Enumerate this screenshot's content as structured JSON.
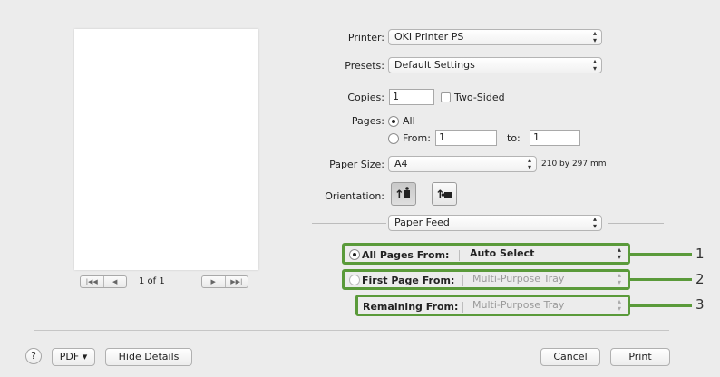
{
  "printer": {
    "label": "Printer:",
    "value": "OKI Printer PS"
  },
  "presets": {
    "label": "Presets:",
    "value": "Default Settings"
  },
  "copies": {
    "label": "Copies:",
    "value": "1",
    "two_sided_label": "Two-Sided",
    "two_sided_checked": false
  },
  "pages": {
    "label": "Pages:",
    "all_label": "All",
    "from_label": "From:",
    "from_value": "1",
    "to_label": "to:",
    "to_value": "1",
    "selected": "All"
  },
  "paper_size": {
    "label": "Paper Size:",
    "value": "A4",
    "dimensions": "210 by 297 mm"
  },
  "orientation": {
    "label": "Orientation:",
    "selected": "portrait",
    "icons": [
      "portrait-icon",
      "landscape-icon"
    ]
  },
  "section": {
    "value": "Paper Feed"
  },
  "paper_feed": {
    "all_pages_label": "All Pages From:",
    "all_pages_value": "Auto Select",
    "first_page_label": "First Page From:",
    "first_page_value": "Multi-Purpose Tray",
    "remaining_label": "Remaining From:",
    "remaining_value": "Multi-Purpose Tray",
    "selected": "All Pages From"
  },
  "callouts": [
    "1",
    "2",
    "3"
  ],
  "preview": {
    "page_indicator": "1 of 1"
  },
  "footer": {
    "help_label": "?",
    "pdf_label": "PDF ▾",
    "hide_details_label": "Hide Details",
    "cancel_label": "Cancel",
    "print_label": "Print"
  },
  "colors": {
    "callout_green": "#5a9a3a",
    "background": "#ececec"
  }
}
